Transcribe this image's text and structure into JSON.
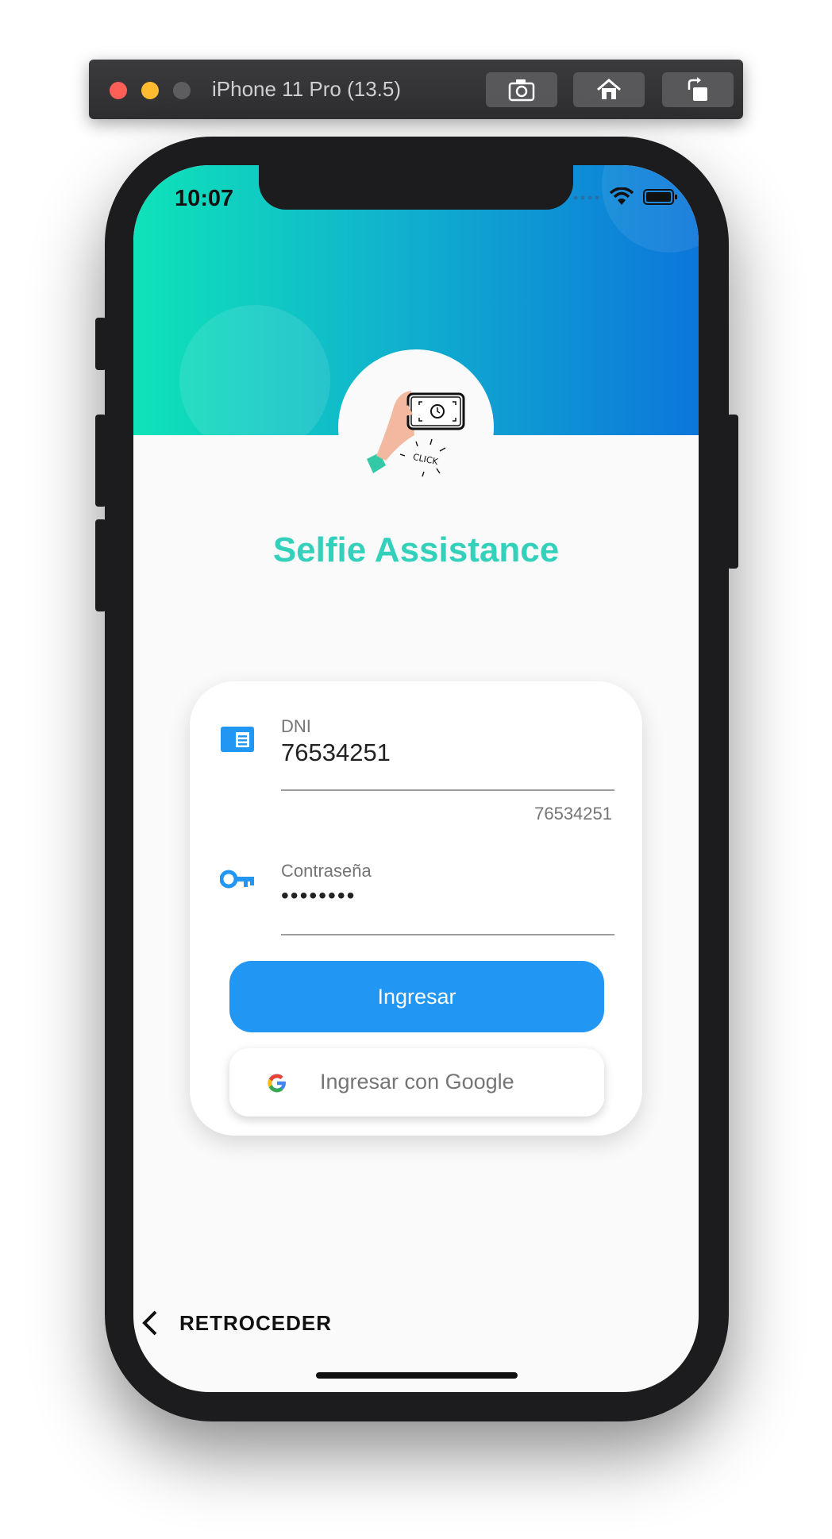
{
  "simulator": {
    "title": "iPhone 11 Pro (13.5)",
    "buttons": [
      "screenshot-icon",
      "home-icon",
      "rotate-icon"
    ]
  },
  "status_bar": {
    "time": "10:07"
  },
  "app": {
    "title": "Selfie Assistance",
    "illustration_text": "CLICK"
  },
  "form": {
    "dni": {
      "label": "DNI",
      "value": "76534251",
      "helper": "76534251"
    },
    "password": {
      "label": "Contraseña",
      "value": "••••••••"
    },
    "login_button": "Ingresar",
    "google_button": "Ingresar con Google"
  },
  "footer": {
    "back_label": "RETROCEDER"
  },
  "colors": {
    "accent": "#2196f3",
    "title": "#33d1bb",
    "gradient_start": "#0fe3b8",
    "gradient_end": "#0c76db"
  }
}
